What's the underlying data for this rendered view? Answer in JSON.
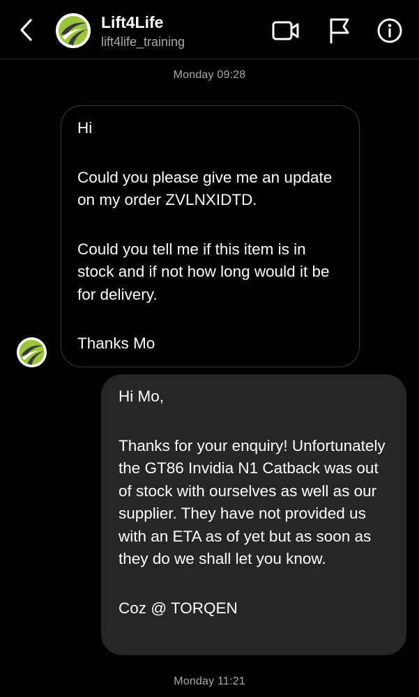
{
  "header": {
    "title": "Lift4Life",
    "username": "lift4life_training",
    "icons": {
      "back": "chevron-left-icon",
      "video": "video-call-icon",
      "flag": "flag-icon",
      "info": "info-icon"
    }
  },
  "messages": [
    {
      "timestamp": "Monday 09:28",
      "direction": "incoming",
      "paragraphs": [
        "Hi",
        "Could you please give me an update on my order ZVLNXIDTD.",
        "Could you tell me if this item is in stock and if not how long would it be for delivery.",
        "Thanks Mo"
      ]
    },
    {
      "direction": "outgoing",
      "paragraphs": [
        "Hi Mo,",
        "Thanks for your enquiry! Unfortunately the GT86 Invidia N1 Catback was out of stock with ourselves as well as our supplier. They have not provided us with an ETA as of yet but as soon as they do we shall let you know.",
        "Coz @ TORQEN"
      ]
    }
  ],
  "footer_timestamp": "Monday 11:21",
  "colors": {
    "background": "#000000",
    "outgoing_bubble": "#262626",
    "incoming_border": "#3a3a3a",
    "secondary_text": "#a8a8a8",
    "logo_green": "#9bc53d",
    "logo_dark": "#3a3a3a"
  }
}
